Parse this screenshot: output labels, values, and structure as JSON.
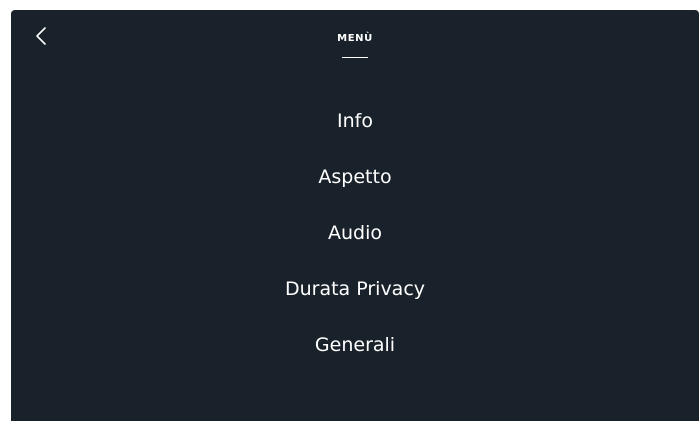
{
  "header": {
    "back_icon": "chevron-left-icon",
    "title": "MENÙ"
  },
  "menu": {
    "items": [
      {
        "label": "Info"
      },
      {
        "label": "Aspetto"
      },
      {
        "label": "Audio"
      },
      {
        "label": "Durata Privacy"
      },
      {
        "label": "Generali"
      }
    ]
  },
  "colors": {
    "background": "#19222a",
    "text": "#ffffff",
    "page": "#ffffff"
  }
}
